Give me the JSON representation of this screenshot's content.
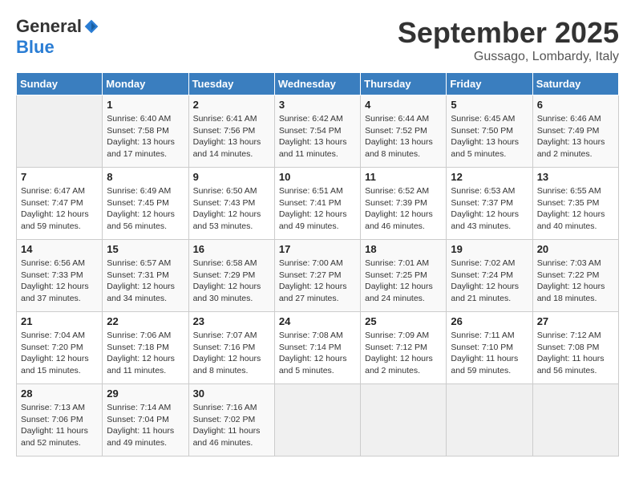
{
  "logo": {
    "general": "General",
    "blue": "Blue"
  },
  "title": "September 2025",
  "location": "Gussago, Lombardy, Italy",
  "days_of_week": [
    "Sunday",
    "Monday",
    "Tuesday",
    "Wednesday",
    "Thursday",
    "Friday",
    "Saturday"
  ],
  "weeks": [
    [
      {
        "day": "",
        "info": ""
      },
      {
        "day": "1",
        "info": "Sunrise: 6:40 AM\nSunset: 7:58 PM\nDaylight: 13 hours\nand 17 minutes."
      },
      {
        "day": "2",
        "info": "Sunrise: 6:41 AM\nSunset: 7:56 PM\nDaylight: 13 hours\nand 14 minutes."
      },
      {
        "day": "3",
        "info": "Sunrise: 6:42 AM\nSunset: 7:54 PM\nDaylight: 13 hours\nand 11 minutes."
      },
      {
        "day": "4",
        "info": "Sunrise: 6:44 AM\nSunset: 7:52 PM\nDaylight: 13 hours\nand 8 minutes."
      },
      {
        "day": "5",
        "info": "Sunrise: 6:45 AM\nSunset: 7:50 PM\nDaylight: 13 hours\nand 5 minutes."
      },
      {
        "day": "6",
        "info": "Sunrise: 6:46 AM\nSunset: 7:49 PM\nDaylight: 13 hours\nand 2 minutes."
      }
    ],
    [
      {
        "day": "7",
        "info": "Sunrise: 6:47 AM\nSunset: 7:47 PM\nDaylight: 12 hours\nand 59 minutes."
      },
      {
        "day": "8",
        "info": "Sunrise: 6:49 AM\nSunset: 7:45 PM\nDaylight: 12 hours\nand 56 minutes."
      },
      {
        "day": "9",
        "info": "Sunrise: 6:50 AM\nSunset: 7:43 PM\nDaylight: 12 hours\nand 53 minutes."
      },
      {
        "day": "10",
        "info": "Sunrise: 6:51 AM\nSunset: 7:41 PM\nDaylight: 12 hours\nand 49 minutes."
      },
      {
        "day": "11",
        "info": "Sunrise: 6:52 AM\nSunset: 7:39 PM\nDaylight: 12 hours\nand 46 minutes."
      },
      {
        "day": "12",
        "info": "Sunrise: 6:53 AM\nSunset: 7:37 PM\nDaylight: 12 hours\nand 43 minutes."
      },
      {
        "day": "13",
        "info": "Sunrise: 6:55 AM\nSunset: 7:35 PM\nDaylight: 12 hours\nand 40 minutes."
      }
    ],
    [
      {
        "day": "14",
        "info": "Sunrise: 6:56 AM\nSunset: 7:33 PM\nDaylight: 12 hours\nand 37 minutes."
      },
      {
        "day": "15",
        "info": "Sunrise: 6:57 AM\nSunset: 7:31 PM\nDaylight: 12 hours\nand 34 minutes."
      },
      {
        "day": "16",
        "info": "Sunrise: 6:58 AM\nSunset: 7:29 PM\nDaylight: 12 hours\nand 30 minutes."
      },
      {
        "day": "17",
        "info": "Sunrise: 7:00 AM\nSunset: 7:27 PM\nDaylight: 12 hours\nand 27 minutes."
      },
      {
        "day": "18",
        "info": "Sunrise: 7:01 AM\nSunset: 7:25 PM\nDaylight: 12 hours\nand 24 minutes."
      },
      {
        "day": "19",
        "info": "Sunrise: 7:02 AM\nSunset: 7:24 PM\nDaylight: 12 hours\nand 21 minutes."
      },
      {
        "day": "20",
        "info": "Sunrise: 7:03 AM\nSunset: 7:22 PM\nDaylight: 12 hours\nand 18 minutes."
      }
    ],
    [
      {
        "day": "21",
        "info": "Sunrise: 7:04 AM\nSunset: 7:20 PM\nDaylight: 12 hours\nand 15 minutes."
      },
      {
        "day": "22",
        "info": "Sunrise: 7:06 AM\nSunset: 7:18 PM\nDaylight: 12 hours\nand 11 minutes."
      },
      {
        "day": "23",
        "info": "Sunrise: 7:07 AM\nSunset: 7:16 PM\nDaylight: 12 hours\nand 8 minutes."
      },
      {
        "day": "24",
        "info": "Sunrise: 7:08 AM\nSunset: 7:14 PM\nDaylight: 12 hours\nand 5 minutes."
      },
      {
        "day": "25",
        "info": "Sunrise: 7:09 AM\nSunset: 7:12 PM\nDaylight: 12 hours\nand 2 minutes."
      },
      {
        "day": "26",
        "info": "Sunrise: 7:11 AM\nSunset: 7:10 PM\nDaylight: 11 hours\nand 59 minutes."
      },
      {
        "day": "27",
        "info": "Sunrise: 7:12 AM\nSunset: 7:08 PM\nDaylight: 11 hours\nand 56 minutes."
      }
    ],
    [
      {
        "day": "28",
        "info": "Sunrise: 7:13 AM\nSunset: 7:06 PM\nDaylight: 11 hours\nand 52 minutes."
      },
      {
        "day": "29",
        "info": "Sunrise: 7:14 AM\nSunset: 7:04 PM\nDaylight: 11 hours\nand 49 minutes."
      },
      {
        "day": "30",
        "info": "Sunrise: 7:16 AM\nSunset: 7:02 PM\nDaylight: 11 hours\nand 46 minutes."
      },
      {
        "day": "",
        "info": ""
      },
      {
        "day": "",
        "info": ""
      },
      {
        "day": "",
        "info": ""
      },
      {
        "day": "",
        "info": ""
      }
    ]
  ]
}
